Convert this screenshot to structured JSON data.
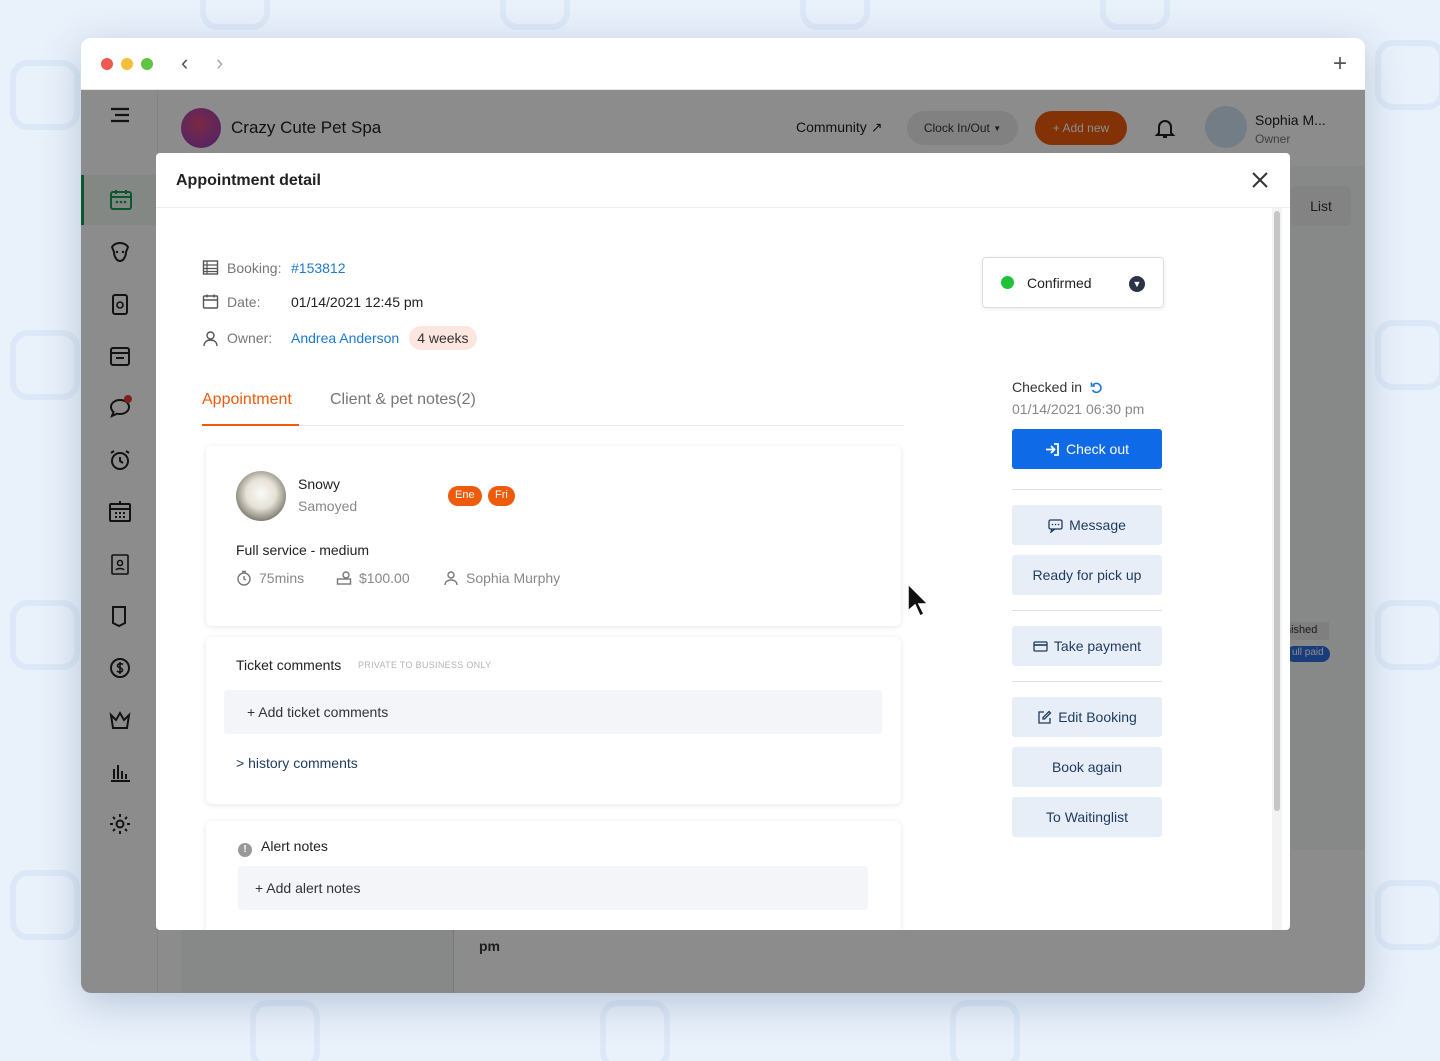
{
  "app": {
    "business_name": "Crazy Cute Pet Spa",
    "community_label": "Community",
    "clock_label": "Clock In/Out",
    "add_new_label": "+ Add new",
    "user_name": "Sophia M...",
    "user_role": "Owner",
    "calendar_view_label": "List",
    "calendar_pm_label": "pm",
    "calendar_fragment_status": "nished",
    "calendar_fragment_paid": "ull paid"
  },
  "sidebar": {
    "items": [
      "calendar-icon",
      "dog-icon",
      "pet-food-icon",
      "schedule-icon",
      "chat-icon",
      "alarm-icon",
      "date-grid-icon",
      "clipboard-icon",
      "book-icon",
      "dollar-icon",
      "crown-icon",
      "chart-icon",
      "gear-icon"
    ],
    "chat_has_notification": true,
    "active_color": "#1b9e55"
  },
  "modal": {
    "title": "Appointment detail",
    "booking_label": "Booking:",
    "booking_id": "#153812",
    "date_label": "Date:",
    "date_value": "01/14/2021 12:45 pm",
    "owner_label": "Owner:",
    "owner_name": "Andrea Anderson",
    "owner_badge": "4 weeks",
    "tabs": [
      {
        "label": "Appointment",
        "active": true
      },
      {
        "label": "Client & pet notes(2)",
        "active": false
      }
    ],
    "pet": {
      "name": "Snowy",
      "breed": "Samoyed",
      "tags": [
        "Ene",
        "Fri"
      ],
      "service": "Full service - medium",
      "duration": "75mins",
      "price": "$100.00",
      "staff": "Sophia Murphy"
    },
    "ticket_comments": {
      "title": "Ticket comments",
      "private_note": "PRIVATE TO BUSINESS ONLY",
      "add_label": "+ Add ticket comments",
      "history_label": "> history comments"
    },
    "alert_notes": {
      "title": "Alert notes",
      "add_label": "+ Add alert notes"
    },
    "status": {
      "value": "Confirmed",
      "color": "#1ec33b"
    },
    "checked_in": {
      "label": "Checked in",
      "time": "01/14/2021 06:30 pm"
    },
    "actions": {
      "check_out": "Check out",
      "message": "Message",
      "ready_for_pickup": "Ready for pick up",
      "take_payment": "Take payment",
      "edit_booking": "Edit Booking",
      "book_again": "Book again",
      "to_waitinglist": "To Waitinglist"
    },
    "accent_color": "#ef5b0c",
    "primary_color": "#0f6ae8"
  }
}
